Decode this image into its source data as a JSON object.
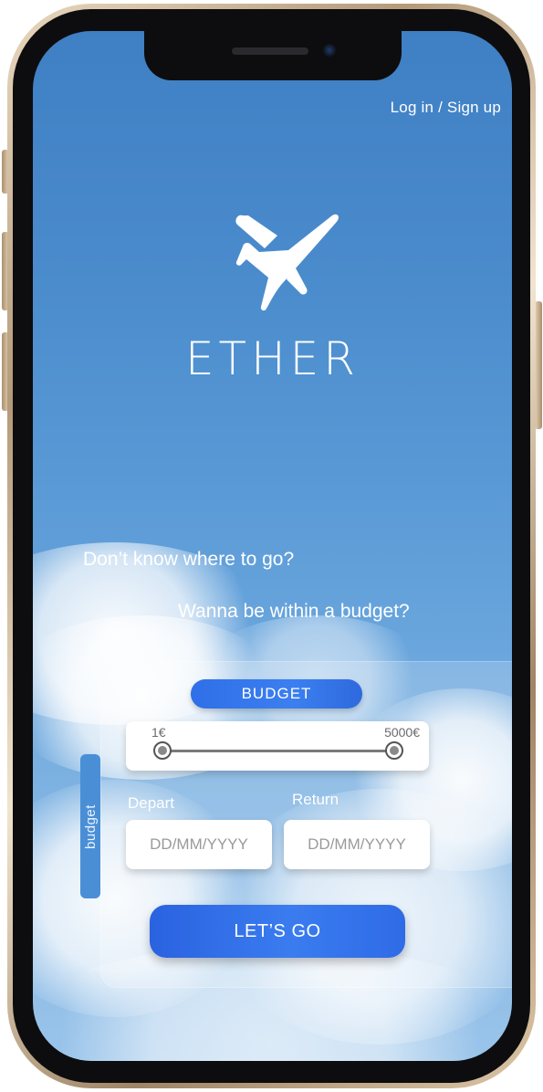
{
  "header": {
    "login_link": "Log in / Sign up"
  },
  "brand": {
    "name": "ETHER",
    "logo_icon": "airplane-icon"
  },
  "taglines": {
    "line1": "Don’t know where to go?",
    "line2": "Wanna be within a budget?"
  },
  "budget": {
    "side_tab_label": "budget",
    "pill_label": "BUDGET",
    "min_label": "1€",
    "max_label": "5000€",
    "min_fraction": 0,
    "max_fraction": 1
  },
  "dates": {
    "depart_label": "Depart",
    "return_label": "Return",
    "depart_placeholder": "DD/MM/YYYY",
    "return_placeholder": "DD/MM/YYYY"
  },
  "actions": {
    "go_label": "LET’S GO"
  },
  "colors": {
    "primary_button": "#3a7cf0",
    "sky_top": "#3f7fc4",
    "sky_bottom": "#9ac4ea",
    "frame_gold": "#d2bb98"
  }
}
